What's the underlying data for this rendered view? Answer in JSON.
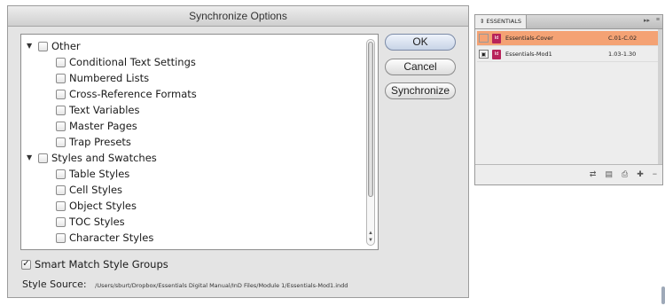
{
  "dialog": {
    "title": "Synchronize Options",
    "tree": [
      {
        "label": "Other",
        "level": 0,
        "expandable": true
      },
      {
        "label": "Conditional Text Settings",
        "level": 1
      },
      {
        "label": "Numbered Lists",
        "level": 1
      },
      {
        "label": "Cross-Reference Formats",
        "level": 1
      },
      {
        "label": "Text Variables",
        "level": 1
      },
      {
        "label": "Master Pages",
        "level": 1
      },
      {
        "label": "Trap Presets",
        "level": 1
      },
      {
        "label": "Styles and Swatches",
        "level": 0,
        "expandable": true
      },
      {
        "label": "Table Styles",
        "level": 1
      },
      {
        "label": "Cell Styles",
        "level": 1
      },
      {
        "label": "Object Styles",
        "level": 1
      },
      {
        "label": "TOC Styles",
        "level": 1
      },
      {
        "label": "Character Styles",
        "level": 1
      }
    ],
    "buttons": {
      "ok": "OK",
      "cancel": "Cancel",
      "synchronize": "Synchronize"
    },
    "smart_match": {
      "label": "Smart Match Style Groups",
      "checked": true
    },
    "style_source": {
      "label": "Style Source:",
      "path": "/Users/sburt/Dropbox/Essentials Digital Manual/InD Files/Module 1/Essentials-Mod1.indd"
    }
  },
  "panel": {
    "tab": "ESSENTIALS",
    "documents": [
      {
        "name": "Essentials-Cover",
        "pages": "C.01-C.02",
        "selected": true,
        "style_source": false
      },
      {
        "name": "Essentials-Mod1",
        "pages": "1.03-1.30",
        "selected": false,
        "style_source": true
      }
    ],
    "selected_color": "#f4a274"
  }
}
